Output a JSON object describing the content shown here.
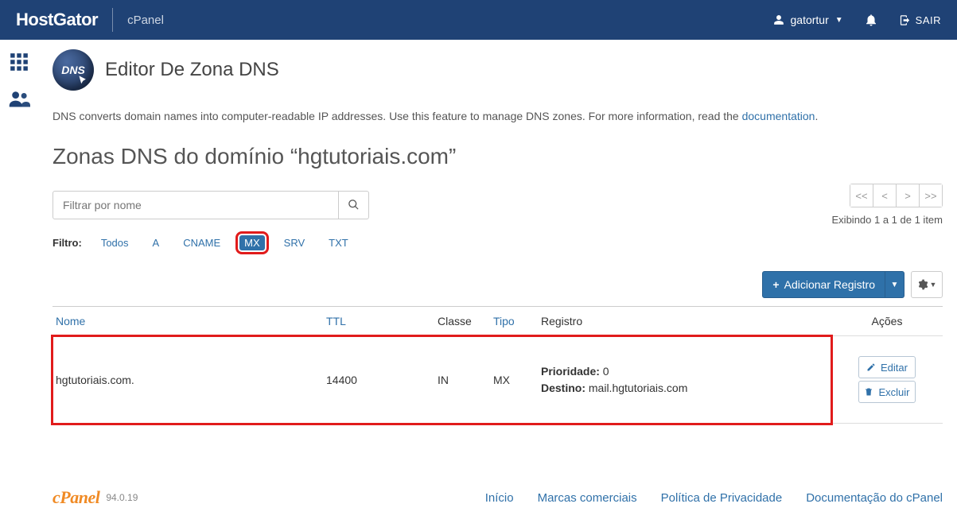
{
  "top": {
    "brand_host": "Host",
    "brand_gator": "Gator",
    "product": "cPanel",
    "user": "gatortur",
    "logout": "SAIR"
  },
  "page": {
    "icon_text": "DNS",
    "title": "Editor De Zona DNS",
    "description_prefix": "DNS converts domain names into computer-readable IP addresses. Use this feature to manage DNS zones. For more information, read the ",
    "description_link": "documentation",
    "description_suffix": ".",
    "section_title": "Zonas DNS do domínio “hgtutoriais.com”"
  },
  "search": {
    "placeholder": "Filtrar por nome"
  },
  "pagination": {
    "first": "<<",
    "prev": "<",
    "next": ">",
    "last": ">>",
    "count_text": "Exibindo 1 a 1 de 1 item"
  },
  "filters": {
    "label": "Filtro:",
    "items": [
      "Todos",
      "A",
      "CNAME",
      "MX",
      "SRV",
      "TXT"
    ],
    "active_index": 3
  },
  "actions": {
    "add_record": "Adicionar Registro"
  },
  "table": {
    "headers": {
      "name": "Nome",
      "ttl": "TTL",
      "class": "Classe",
      "type": "Tipo",
      "record": "Registro",
      "actions": "Ações"
    },
    "rows": [
      {
        "name": "hgtutoriais.com.",
        "ttl": "14400",
        "class": "IN",
        "type": "MX",
        "record": {
          "priority_label": "Prioridade:",
          "priority_value": "0",
          "dest_label": "Destino:",
          "dest_value": "mail.hgtutoriais.com"
        }
      }
    ],
    "row_actions": {
      "edit": "Editar",
      "delete": "Excluir"
    }
  },
  "footer": {
    "brand": "cPanel",
    "version": "94.0.19",
    "links": [
      "Início",
      "Marcas comerciais",
      "Política de Privacidade",
      "Documentação do cPanel"
    ]
  }
}
